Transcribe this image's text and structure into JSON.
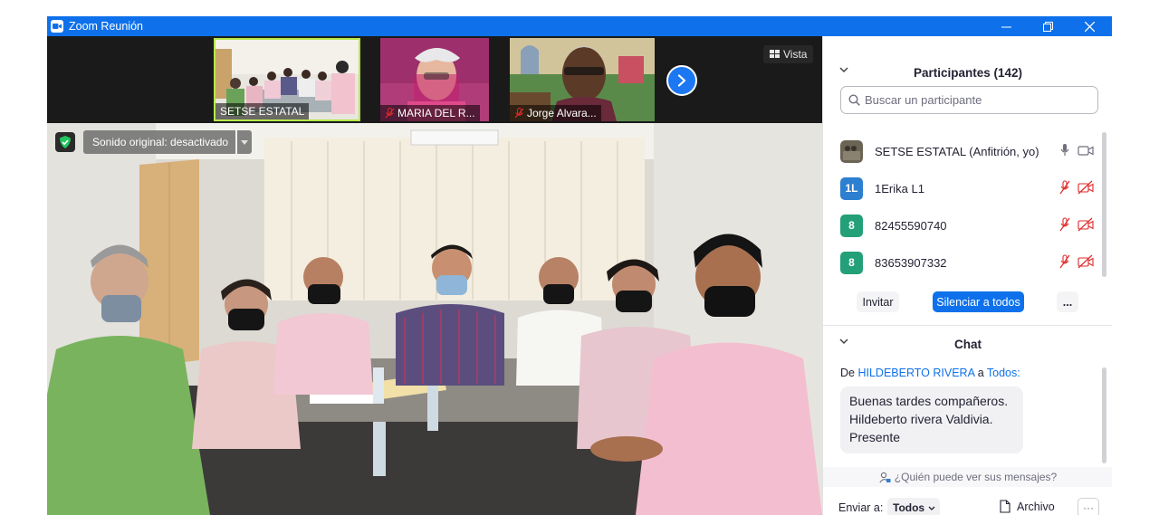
{
  "window": {
    "title": "Zoom Reunión",
    "accent": "#0e71eb"
  },
  "video": {
    "thumbnails": [
      {
        "name": "SETSE ESTATAL",
        "muted": false
      },
      {
        "name": "MARIA DEL R...",
        "muted": true
      },
      {
        "name": "Jorge Alvara...",
        "muted": true
      }
    ],
    "view_label": "Vista",
    "sound_label": "Sonido original: desactivado"
  },
  "participants": {
    "header": "Participantes (142)",
    "search_placeholder": "Buscar un participante",
    "list": [
      {
        "avatar": "",
        "name": "SETSE ESTATAL (Anfitrión, yo)",
        "color": "#6b6455"
      },
      {
        "avatar": "1L",
        "name": "1Erika L1",
        "color": "#2d7fd0"
      },
      {
        "avatar": "8",
        "name": "82455590740",
        "color": "#23a078"
      },
      {
        "avatar": "8",
        "name": "83653907332",
        "color": "#23a078"
      }
    ],
    "invite_label": "Invitar",
    "mute_all_label": "Silenciar a todos",
    "more_label": "..."
  },
  "chat": {
    "header": "Chat",
    "from_prefix": "De",
    "from_name": "HILDEBERTO RIVERA",
    "to_word": "a",
    "to_name": "Todos:",
    "message_lines": [
      "Buenas tardes compañeros.",
      "Hildeberto rivera Valdivia.",
      "Presente"
    ],
    "who_can_see": "¿Quién puede ver sus mensajes?",
    "send_to_label": "Enviar a:",
    "send_to_value": "Todos",
    "file_label": "Archivo",
    "more_label": "···"
  }
}
